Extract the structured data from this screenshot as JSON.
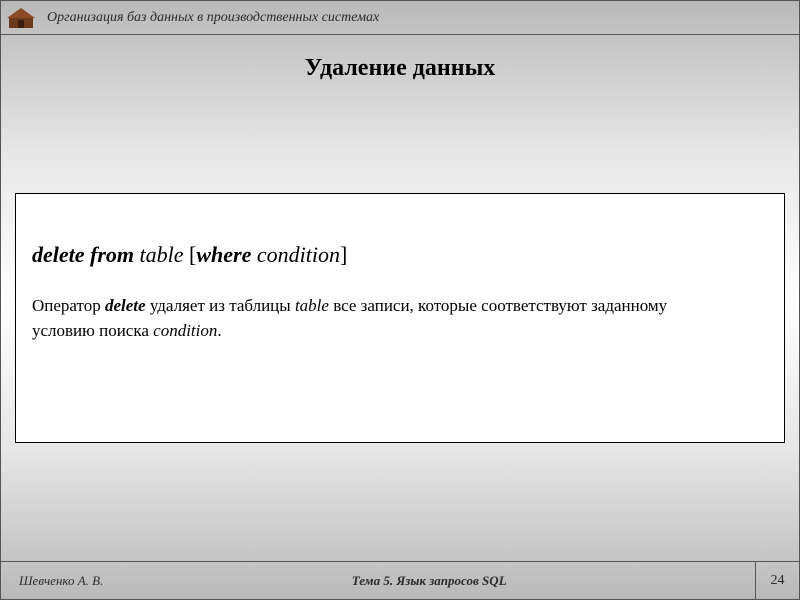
{
  "header": {
    "course_title": "Организация баз данных в производственных системах"
  },
  "slide": {
    "title": "Удаление данных",
    "syntax": {
      "kw_delete_from": "delete from",
      "table": "table",
      "bracket_open": " [",
      "kw_where": "where",
      "condition": " condition",
      "bracket_close": "]"
    },
    "description": {
      "pre": "Оператор ",
      "kw_delete": "delete",
      "mid1": " удаляет из таблицы ",
      "em_table": "table",
      "mid2": " все записи, которые соответствуют заданному условию поиска ",
      "em_condition": "condition",
      "post": "."
    }
  },
  "footer": {
    "author": "Шевченко А. В.",
    "topic": "Тема 5. Язык запросов SQL",
    "page": "24"
  }
}
